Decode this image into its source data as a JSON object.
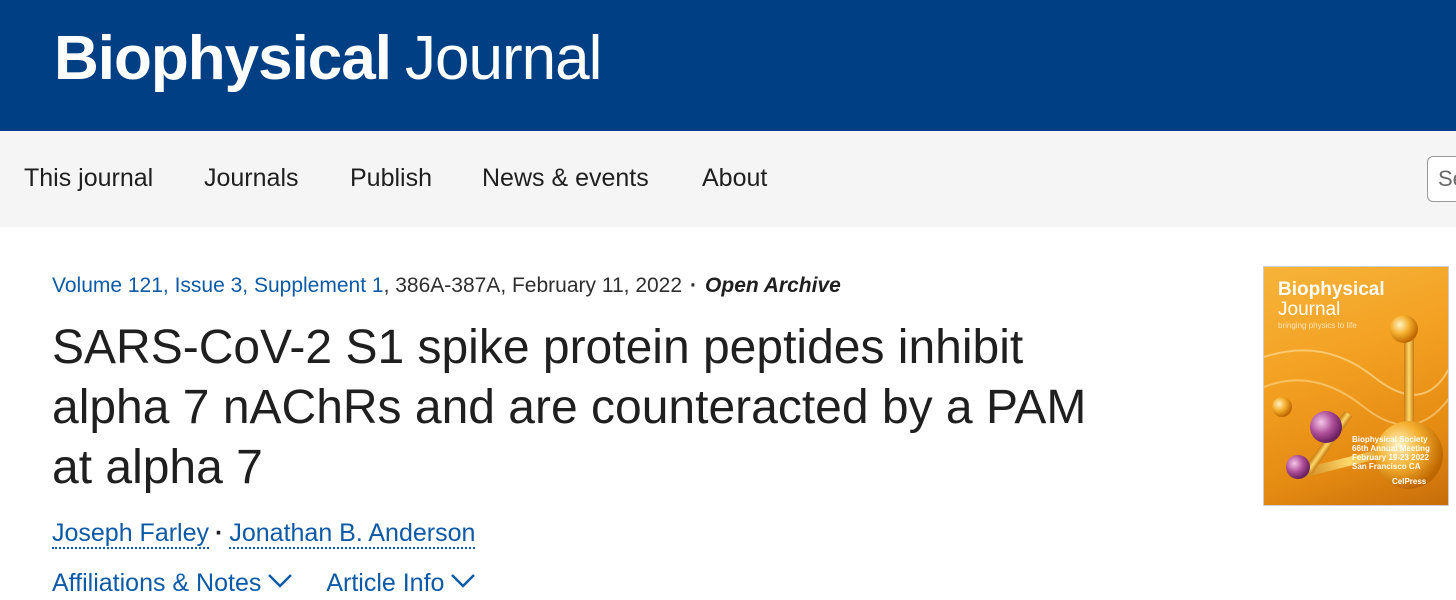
{
  "header": {
    "brand_bold": "Biophysical",
    "brand_light": "Journal"
  },
  "nav": {
    "items": [
      {
        "label": "This journal"
      },
      {
        "label": "Journals"
      },
      {
        "label": "Publish"
      },
      {
        "label": "News & events"
      },
      {
        "label": "About"
      }
    ],
    "search_text": "Se"
  },
  "article": {
    "volume_link": "Volume 121, Issue 3, Supplement 1",
    "pages_date": ", 386A-387A, February 11, 2022",
    "separator": "·",
    "access": "Open Archive",
    "title": "SARS-CoV-2 S1 spike protein peptides inhibit alpha 7 nAChRs and are counteracted by a PAM at alpha 7",
    "authors": [
      {
        "name": "Joseph Farley"
      },
      {
        "name": "Jonathan B. Anderson"
      }
    ],
    "author_separator": "·",
    "toggles": {
      "affiliations": "Affiliations & Notes",
      "article_info": "Article Info"
    }
  },
  "cover": {
    "title_bold": "Biophysical",
    "title_light": "Journal",
    "subtitle": "bringing physics to life",
    "event": "Biophysical Society 66th Annual Meeting February 19-23 2022 San Francisco CA",
    "publisher": "CelPress"
  },
  "colors": {
    "header_bg": "#003f84",
    "nav_bg": "#f5f5f5",
    "link": "#0c5aa6",
    "text": "#1f1f1f"
  }
}
